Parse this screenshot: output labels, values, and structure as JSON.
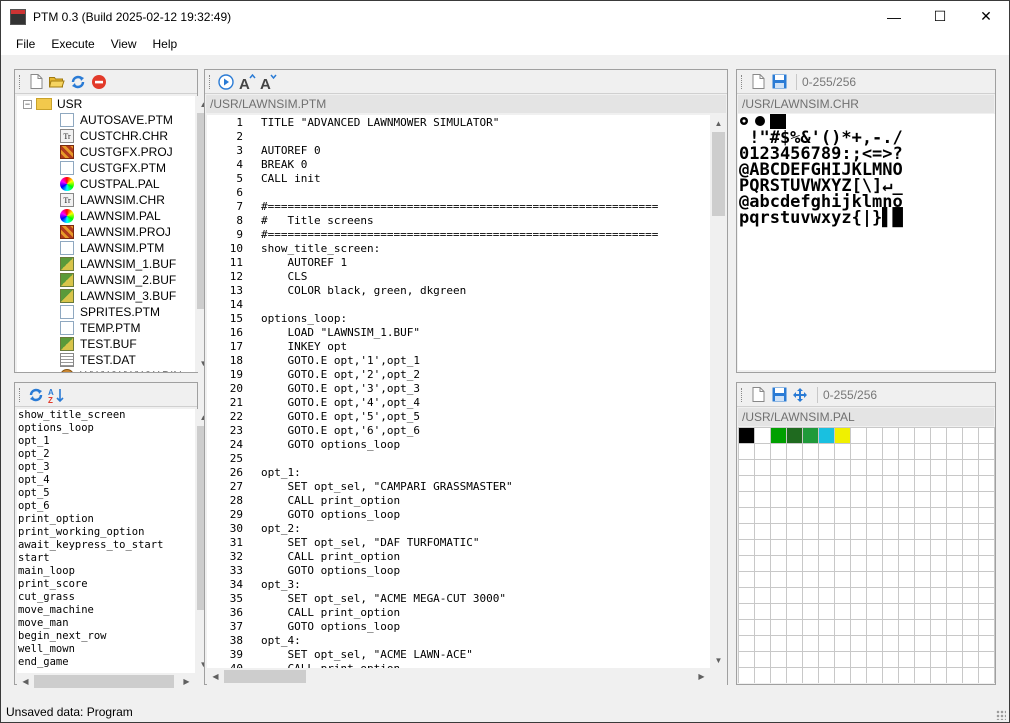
{
  "window": {
    "title": "PTM 0.3 (Build 2025-02-12 19:32:49)",
    "controls": {
      "minimize": "—",
      "maximize": "☐",
      "close": "✕"
    }
  },
  "menu": [
    "File",
    "Execute",
    "View",
    "Help"
  ],
  "file_panel": {
    "toolbar_icons": [
      "new-file-icon",
      "open-folder-icon",
      "refresh-icon",
      "delete-icon"
    ],
    "root": {
      "label": "USR",
      "expander": "−"
    },
    "files": [
      {
        "name": "AUTOSAVE.PTM",
        "icon": "ptm"
      },
      {
        "name": "CUSTCHR.CHR",
        "icon": "chr"
      },
      {
        "name": "CUSTGFX.PROJ",
        "icon": "proj"
      },
      {
        "name": "CUSTGFX.PTM",
        "icon": "ptm"
      },
      {
        "name": "CUSTPAL.PAL",
        "icon": "pal"
      },
      {
        "name": "LAWNSIM.CHR",
        "icon": "chr"
      },
      {
        "name": "LAWNSIM.PAL",
        "icon": "pal"
      },
      {
        "name": "LAWNSIM.PROJ",
        "icon": "proj"
      },
      {
        "name": "LAWNSIM.PTM",
        "icon": "ptm"
      },
      {
        "name": "LAWNSIM_1.BUF",
        "icon": "buf"
      },
      {
        "name": "LAWNSIM_2.BUF",
        "icon": "buf"
      },
      {
        "name": "LAWNSIM_3.BUF",
        "icon": "buf"
      },
      {
        "name": "SPRITES.PTM",
        "icon": "ptm"
      },
      {
        "name": "TEMP.PTM",
        "icon": "ptm"
      },
      {
        "name": "TEST.BUF",
        "icon": "buf"
      },
      {
        "name": "TEST.DAT",
        "icon": "dat"
      },
      {
        "name": "WWWWWWW.BIN",
        "icon": "bin"
      }
    ]
  },
  "labels_panel": {
    "toolbar_icons": [
      "refresh-icon",
      "sort-az-icon"
    ],
    "labels": [
      "show_title_screen",
      "options_loop",
      "opt_1",
      "opt_2",
      "opt_3",
      "opt_4",
      "opt_5",
      "opt_6",
      "print_option",
      "print_working_option",
      "await_keypress_to_start",
      "start",
      "main_loop",
      "print_score",
      "cut_grass",
      "move_machine",
      "move_man",
      "begin_next_row",
      "well_mown",
      "end_game"
    ]
  },
  "editor": {
    "toolbar_icons": [
      "run-icon",
      "font-increase-icon",
      "font-decrease-icon"
    ],
    "path": "/USR/LAWNSIM.PTM",
    "lines": [
      "TITLE \"ADVANCED LAWNMOWER SIMULATOR\"",
      "",
      "AUTOREF 0",
      "BREAK 0",
      "CALL init",
      "",
      "#===========================================================",
      "#   Title screens",
      "#===========================================================",
      "show_title_screen:",
      "    AUTOREF 1",
      "    CLS",
      "    COLOR black, green, dkgreen",
      "",
      "options_loop:",
      "    LOAD \"LAWNSIM_1.BUF\"",
      "    INKEY opt",
      "    GOTO.E opt,'1',opt_1",
      "    GOTO.E opt,'2',opt_2",
      "    GOTO.E opt,'3',opt_3",
      "    GOTO.E opt,'4',opt_4",
      "    GOTO.E opt,'5',opt_5",
      "    GOTO.E opt,'6',opt_6",
      "    GOTO options_loop",
      "",
      "opt_1:",
      "    SET opt_sel, \"CAMPARI GRASSMASTER\"",
      "    CALL print_option",
      "    GOTO options_loop",
      "opt_2:",
      "    SET opt_sel, \"DAF TURFOMATIC\"",
      "    CALL print_option",
      "    GOTO options_loop",
      "opt_3:",
      "    SET opt_sel, \"ACME MEGA-CUT 3000\"",
      "    CALL print_option",
      "    GOTO options_loop",
      "opt_4:",
      "    SET opt_sel, \"ACME LAWN-ACE\"",
      "    CALL print_option"
    ]
  },
  "charset_panel": {
    "range": "0-255/256",
    "path": "/USR/LAWNSIM.CHR",
    "rows": [
      " !\"#$%&'()*+,-./",
      "0123456789:;<=>?",
      "@ABCDEFGHIJKLMNO",
      "PQRSTUVWXYZ[\\]↵_",
      "@abcdefghijklmno",
      "pqrstuvwxyz{|}▌█"
    ]
  },
  "palette_panel": {
    "range": "0-255/256",
    "path": "/USR/LAWNSIM.PAL",
    "colors": [
      "#000000",
      "#ffffff",
      "#00a000",
      "#1f6a1f",
      "#1f9a3a",
      "#19c0e0",
      "#f0f000"
    ]
  },
  "status": "Unsaved data: Program"
}
